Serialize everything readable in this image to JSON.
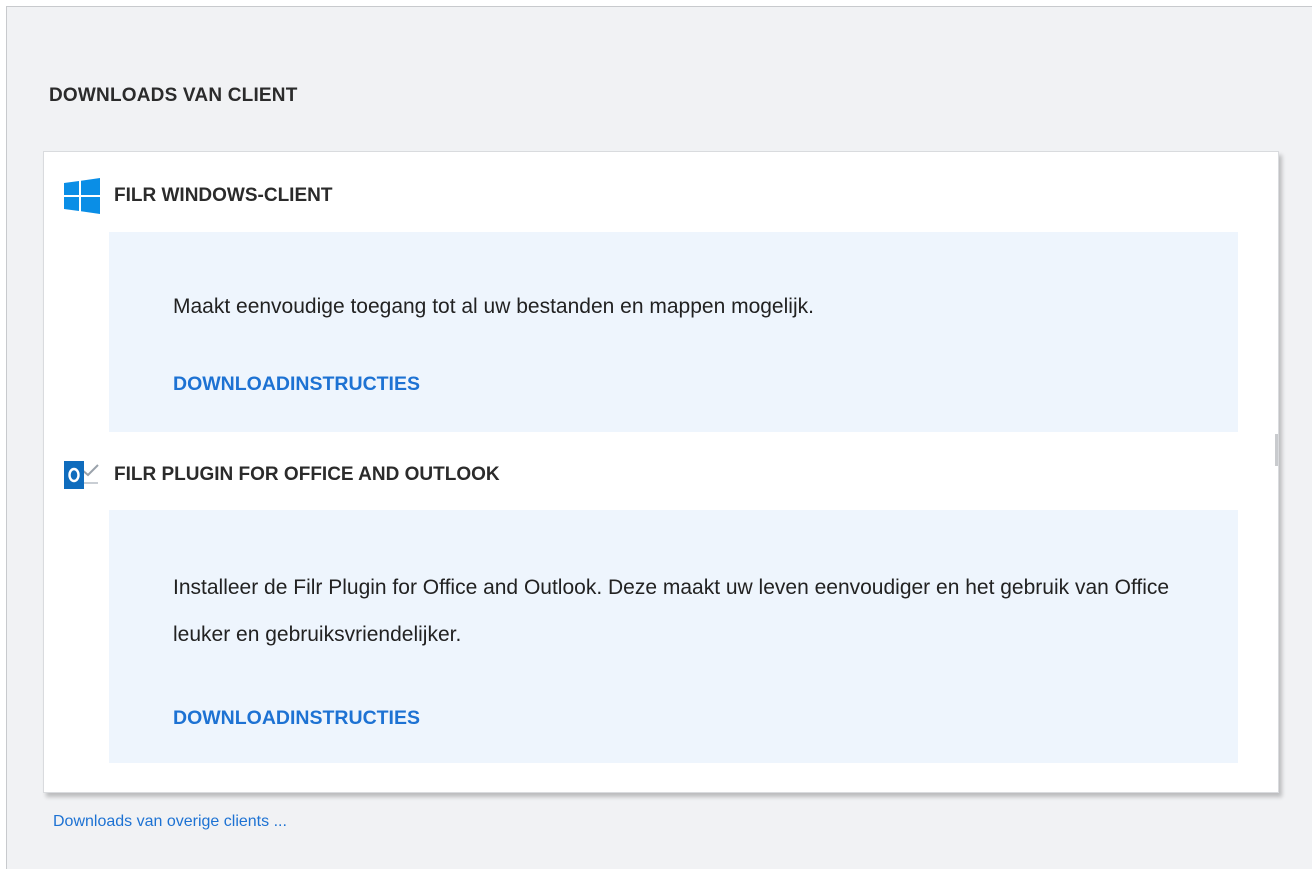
{
  "section": {
    "title": "DOWNLOADS VAN CLIENT"
  },
  "clients": [
    {
      "icon": "windows-icon",
      "title": "FILR WINDOWS-CLIENT",
      "description": "Maakt eenvoudige toegang tot al uw bestanden en mappen mogelijk.",
      "link_label": "DOWNLOADINSTRUCTIES"
    },
    {
      "icon": "outlook-icon",
      "title": "FILR PLUGIN FOR OFFICE AND OUTLOOK",
      "description": "Installeer de Filr Plugin for Office and Outlook. Deze maakt uw leven eenvoudiger en het gebruik van Office leuker en gebruiksvriendelijker.",
      "link_label": "DOWNLOADINSTRUCTIES"
    }
  ],
  "footer": {
    "other_link": "Downloads van overige clients ..."
  },
  "colors": {
    "accent": "#1d72d3",
    "windows_blue": "#0a8ee6",
    "outlook_blue": "#0f6cbd",
    "info_box_bg": "#eef5fd",
    "panel_bg": "#f1f2f4"
  }
}
